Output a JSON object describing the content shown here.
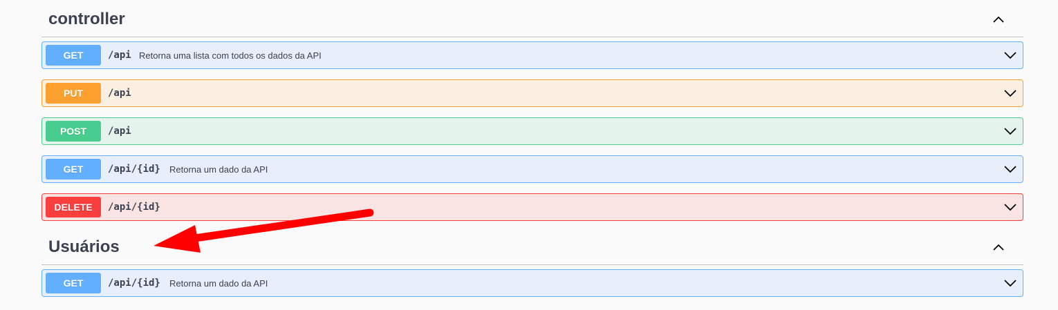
{
  "sections": [
    {
      "title": "controller",
      "operations": [
        {
          "method": "GET",
          "path": "/api",
          "summary": "Retorna uma lista com todos os dados da API"
        },
        {
          "method": "PUT",
          "path": "/api",
          "summary": ""
        },
        {
          "method": "POST",
          "path": "/api",
          "summary": ""
        },
        {
          "method": "GET",
          "path": "/api/{id}",
          "summary": "Retorna um dado da API"
        },
        {
          "method": "DELETE",
          "path": "/api/{id}",
          "summary": ""
        }
      ]
    },
    {
      "title": "Usuários",
      "operations": [
        {
          "method": "GET",
          "path": "/api/{id}",
          "summary": "Retorna um dado da API"
        }
      ]
    }
  ],
  "icons": {
    "section_toggle": "chevron-up-icon",
    "operation_toggle": "chevron-down-icon",
    "annotation": "red-arrow-annotation"
  },
  "colors": {
    "get": "#61affe",
    "put": "#fca130",
    "post": "#49cc90",
    "delete": "#f93e3e",
    "annotation_arrow": "#ff0000"
  }
}
